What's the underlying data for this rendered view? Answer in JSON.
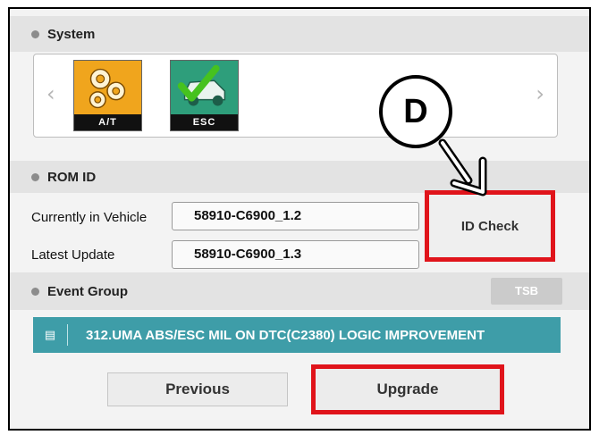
{
  "system": {
    "header": "System",
    "modules": [
      {
        "label": "A/T",
        "icon": "gears-icon",
        "color": "#f0a51d"
      },
      {
        "label": "ESC",
        "icon": "car-check-icon",
        "color": "#2e9e7b"
      }
    ],
    "prev_glyph": "‹",
    "next_glyph": "›"
  },
  "rom_id": {
    "header": "ROM ID",
    "current_label": "Currently in Vehicle",
    "current_value": "58910-C6900_1.2",
    "latest_label": "Latest Update",
    "latest_value": "58910-C6900_1.3",
    "id_check_label": "ID Check"
  },
  "event_group": {
    "header": "Event Group",
    "tsb_label": "TSB",
    "event_text": "312.UMA ABS/ESC MIL ON DTC(C2380) LOGIC IMPROVEMENT"
  },
  "buttons": {
    "previous_label": "Previous",
    "upgrade_label": "Upgrade"
  },
  "callout": {
    "label": "D",
    "highlight_color": "#e0141b"
  }
}
